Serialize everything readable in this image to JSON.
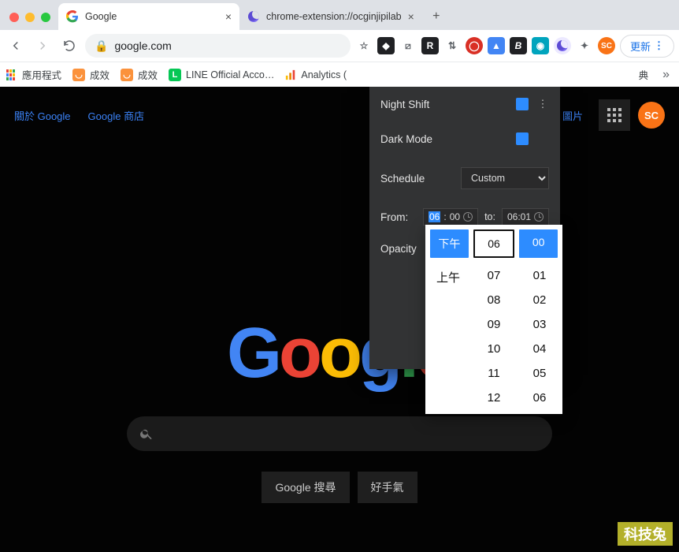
{
  "tabs": [
    {
      "title": "Google",
      "favicon": "google"
    },
    {
      "title": "chrome-extension://ocginjipilab",
      "favicon": "moon"
    }
  ],
  "toolbar": {
    "url": "google.com",
    "update_label": "更新"
  },
  "ext_icons": {
    "r": "R",
    "b": "B",
    "sc": "SC"
  },
  "bookmarks": {
    "apps": "應用程式",
    "items": [
      {
        "label": "成效",
        "icon": "orange"
      },
      {
        "label": "成效",
        "icon": "orange"
      },
      {
        "label": "LINE Official Acco…",
        "icon": "green"
      },
      {
        "label": "Analytics (",
        "icon": "multi"
      }
    ],
    "right_item": "典"
  },
  "google": {
    "about": "關於 Google",
    "store": "Google 商店",
    "images": "圖片",
    "avatar": "SC",
    "search_btn": "Google 搜尋",
    "lucky_btn": "好手氣"
  },
  "popup": {
    "night_shift": "Night Shift",
    "dark_mode": "Dark Mode",
    "schedule": "Schedule",
    "schedule_value": "Custom",
    "from": "From:",
    "to": "to:",
    "from_time_h": "06",
    "from_time_m": "00",
    "to_time": "06:01",
    "opacity": "Opacity"
  },
  "time_picker": {
    "ampm_sel": "下午",
    "hour_sel": "06",
    "min_sel": "00",
    "ampm_other": "上午",
    "hours": [
      "07",
      "08",
      "09",
      "10",
      "11",
      "12"
    ],
    "mins": [
      "01",
      "02",
      "03",
      "04",
      "05",
      "06"
    ]
  },
  "watermark": "科技兔"
}
